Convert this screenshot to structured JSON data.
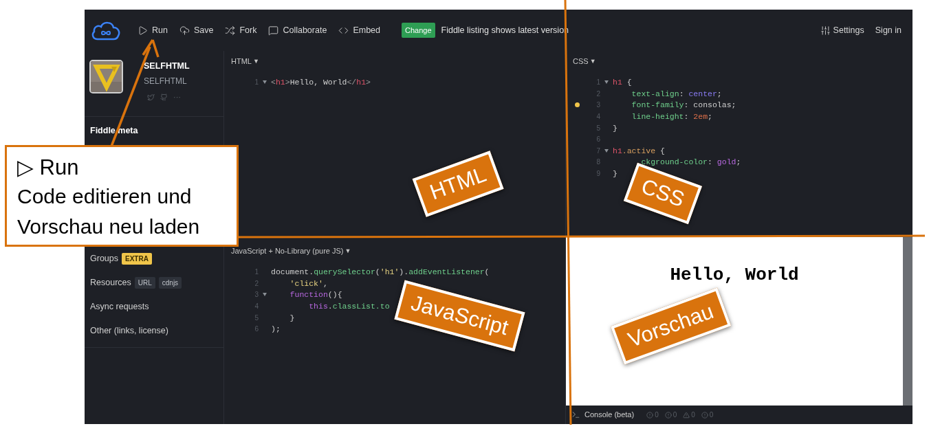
{
  "toolbar": {
    "actions": [
      {
        "label": "Run"
      },
      {
        "label": "Save"
      },
      {
        "label": "Fork"
      },
      {
        "label": "Collaborate"
      },
      {
        "label": "Embed"
      }
    ],
    "notice": {
      "badge": "Change",
      "text": "Fiddle listing shows latest version"
    },
    "settings": "Settings",
    "sign_in": "Sign in"
  },
  "sidebar": {
    "user": {
      "name": "SELFHTML",
      "handle": "SELFHTML",
      "more": "···"
    },
    "section_title": "Fiddle meta",
    "items": [
      {
        "label": "Groups",
        "tags": [
          {
            "text": "EXTRA",
            "color": "#f0c54a"
          }
        ]
      },
      {
        "label": "Resources",
        "tags": [
          {
            "text": "URL",
            "color": "#2e323a"
          },
          {
            "text": "cdnjs",
            "color": "#2e323a"
          }
        ]
      },
      {
        "label": "Async requests"
      },
      {
        "label": "Other (links, license)"
      }
    ]
  },
  "panels": [
    {
      "title": "HTML",
      "caret": "▼",
      "lines": [
        {
          "number": "1",
          "fold": true,
          "warning": false,
          "segments": [
            {
              "kind": "punct",
              "text": "<"
            },
            {
              "kind": "tag",
              "text": "h1"
            },
            {
              "kind": "punct",
              "text": ">"
            },
            {
              "kind": "plain",
              "text": "Hello, World"
            },
            {
              "kind": "punct",
              "text": "</"
            },
            {
              "kind": "tag",
              "text": "h1"
            },
            {
              "kind": "punct",
              "text": ">"
            }
          ]
        }
      ]
    },
    {
      "title": "CSS",
      "caret": "▼",
      "lines": [
        {
          "number": "1",
          "fold": true,
          "warning": false,
          "segments": [
            {
              "kind": "tag",
              "text": "h1"
            },
            {
              "kind": "plain",
              "text": " {"
            }
          ]
        },
        {
          "number": "2",
          "fold": false,
          "warning": false,
          "segments": [
            {
              "kind": "prop",
              "text": "    text-align"
            },
            {
              "kind": "plain",
              "text": ": "
            },
            {
              "kind": "valkw",
              "text": "center"
            },
            {
              "kind": "plain",
              "text": ";"
            }
          ]
        },
        {
          "number": "3",
          "fold": false,
          "warning": true,
          "segments": [
            {
              "kind": "prop",
              "text": "    font-family"
            },
            {
              "kind": "plain",
              "text": ": consolas;"
            }
          ]
        },
        {
          "number": "4",
          "fold": false,
          "warning": false,
          "segments": [
            {
              "kind": "prop",
              "text": "    line-height"
            },
            {
              "kind": "plain",
              "text": ": "
            },
            {
              "kind": "num",
              "text": "2em"
            },
            {
              "kind": "plain",
              "text": ";"
            }
          ]
        },
        {
          "number": "5",
          "fold": false,
          "warning": false,
          "segments": [
            {
              "kind": "plain",
              "text": "}"
            }
          ]
        },
        {
          "number": "6",
          "fold": false,
          "warning": false
        },
        {
          "number": "7",
          "fold": true,
          "warning": false,
          "segments": [
            {
              "kind": "tag",
              "text": "h1"
            },
            {
              "kind": "attr",
              "text": ".active"
            },
            {
              "kind": "plain",
              "text": " {"
            }
          ]
        },
        {
          "number": "8",
          "fold": false,
          "warning": false,
          "segments": [
            {
              "kind": "prop",
              "text": "      ckground-color"
            },
            {
              "kind": "plain",
              "text": ": "
            },
            {
              "kind": "kw",
              "text": "gold"
            },
            {
              "kind": "plain",
              "text": ";"
            }
          ]
        },
        {
          "number": "9",
          "fold": false,
          "warning": false,
          "segments": [
            {
              "kind": "plain",
              "text": "}"
            }
          ]
        }
      ]
    },
    {
      "title": "JavaScript + No-Library (pure JS)",
      "caret": "▼",
      "lines": [
        {
          "number": "1",
          "fold": false,
          "warning": false,
          "segments": [
            {
              "kind": "plain",
              "text": "document."
            },
            {
              "kind": "fn",
              "text": "querySelector"
            },
            {
              "kind": "plain",
              "text": "("
            },
            {
              "kind": "str",
              "text": "'h1'"
            },
            {
              "kind": "plain",
              "text": ")."
            },
            {
              "kind": "fn",
              "text": "addEventListener"
            },
            {
              "kind": "plain",
              "text": "("
            }
          ]
        },
        {
          "number": "2",
          "fold": false,
          "warning": false,
          "segments": [
            {
              "kind": "str",
              "text": "    'click'"
            },
            {
              "kind": "plain",
              "text": ","
            }
          ]
        },
        {
          "number": "3",
          "fold": true,
          "warning": false,
          "segments": [
            {
              "kind": "kw",
              "text": "    function"
            },
            {
              "kind": "plain",
              "text": "(){"
            }
          ]
        },
        {
          "number": "4",
          "fold": false,
          "warning": false,
          "segments": [
            {
              "kind": "kw",
              "text": "        this"
            },
            {
              "kind": "plain",
              "text": "."
            },
            {
              "kind": "fn",
              "text": "classList.to"
            }
          ]
        },
        {
          "number": "5",
          "fold": false,
          "warning": false,
          "segments": [
            {
              "kind": "plain",
              "text": "    }"
            }
          ]
        },
        {
          "number": "6",
          "fold": false,
          "warning": false,
          "segments": [
            {
              "kind": "plain",
              "text": ");"
            }
          ]
        }
      ]
    }
  ],
  "preview": {
    "heading": "Hello, World"
  },
  "console": {
    "label": "Console (beta)",
    "counters": [
      "0",
      "0",
      "0",
      "0"
    ]
  },
  "annotations": {
    "callout": {
      "title": "▷ Run",
      "lines": [
        "Code editieren und",
        "Vorschau neu laden"
      ]
    },
    "labels": [
      "HTML",
      "CSS",
      "JavaScript",
      "Vorschau"
    ]
  }
}
